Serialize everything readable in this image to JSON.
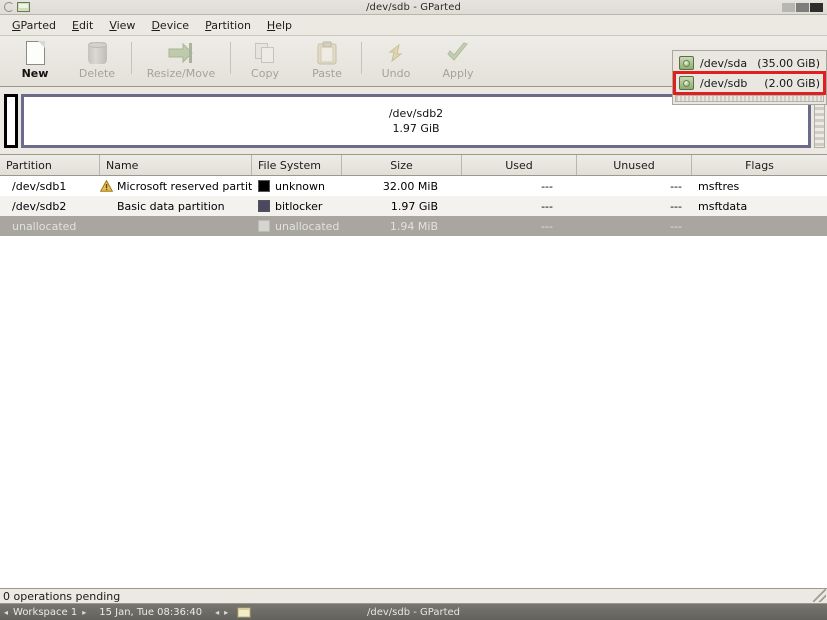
{
  "window": {
    "title": "/dev/sdb - GParted",
    "titlebar_icons": [
      "reload-icon",
      "monitor-icon"
    ],
    "buttons": [
      "minimize-button",
      "maximize-button",
      "close-button"
    ]
  },
  "menubar": {
    "items": [
      {
        "label": "GParted",
        "mnemonic": "G"
      },
      {
        "label": "Edit",
        "mnemonic": "E"
      },
      {
        "label": "View",
        "mnemonic": "V"
      },
      {
        "label": "Device",
        "mnemonic": "D"
      },
      {
        "label": "Partition",
        "mnemonic": "P"
      },
      {
        "label": "Help",
        "mnemonic": "H"
      }
    ]
  },
  "toolbar": {
    "items": [
      {
        "label": "New",
        "icon": "new-document-icon",
        "enabled": true
      },
      {
        "label": "Delete",
        "icon": "trash-can-icon",
        "enabled": false
      },
      {
        "label": "Resize/Move",
        "icon": "resize-arrow-icon",
        "enabled": false
      },
      {
        "label": "Copy",
        "icon": "copy-icon",
        "enabled": false
      },
      {
        "label": "Paste",
        "icon": "clipboard-paste-icon",
        "enabled": false
      },
      {
        "label": "Undo",
        "icon": "undo-arrow-icon",
        "enabled": false
      },
      {
        "label": "Apply",
        "icon": "apply-checkmark-icon",
        "enabled": false
      }
    ]
  },
  "device_selector": {
    "devices": [
      {
        "name": "/dev/sda",
        "size": "(35.00 GiB)",
        "icon": "hard-drive-icon",
        "highlighted": false
      },
      {
        "name": "/dev/sdb",
        "size": "(2.00 GiB)",
        "icon": "hard-drive-icon",
        "highlighted": true
      }
    ],
    "highlight_color": "#e02020"
  },
  "disk_graphic": {
    "partitions": [
      {
        "name": "/dev/sdb1",
        "size": "",
        "border_color": "#000000",
        "width_pct": 1.7,
        "show_label": false
      },
      {
        "name": "/dev/sdb2",
        "size": "1.97 GiB",
        "border_color": "#6d6b8c",
        "width_pct": 98.3,
        "show_label": true
      }
    ]
  },
  "partition_table": {
    "columns": [
      "Partition",
      "Name",
      "File System",
      "Size",
      "Used",
      "Unused",
      "Flags"
    ],
    "rows": [
      {
        "partition": "/dev/sdb1",
        "warning": true,
        "name": "Microsoft reserved partition",
        "filesystem": "unknown",
        "fs_color": "#000000",
        "size": "32.00 MiB",
        "used": "---",
        "unused": "---",
        "flags": "msftres",
        "unallocated": false
      },
      {
        "partition": "/dev/sdb2",
        "warning": false,
        "name": "Basic data partition",
        "filesystem": "bitlocker",
        "fs_color": "#4b4862",
        "size": "1.97 GiB",
        "used": "---",
        "unused": "---",
        "flags": "msftdata",
        "unallocated": false
      },
      {
        "partition": "unallocated",
        "warning": false,
        "name": "",
        "filesystem": "unallocated",
        "fs_color": "#d6d4d0",
        "size": "1.94 MiB",
        "used": "---",
        "unused": "---",
        "flags": "",
        "unallocated": true
      }
    ]
  },
  "statusbar": {
    "text": "0 operations pending"
  },
  "taskbar": {
    "workspace_prev": "◂",
    "workspace_label": "Workspace 1",
    "workspace_next": "▸",
    "clock": "15 Jan, Tue 08:36:40",
    "window_prev": "◂",
    "window_next": "▸",
    "window_icon": "window-icon",
    "active_window_title": "/dev/sdb - GParted"
  }
}
